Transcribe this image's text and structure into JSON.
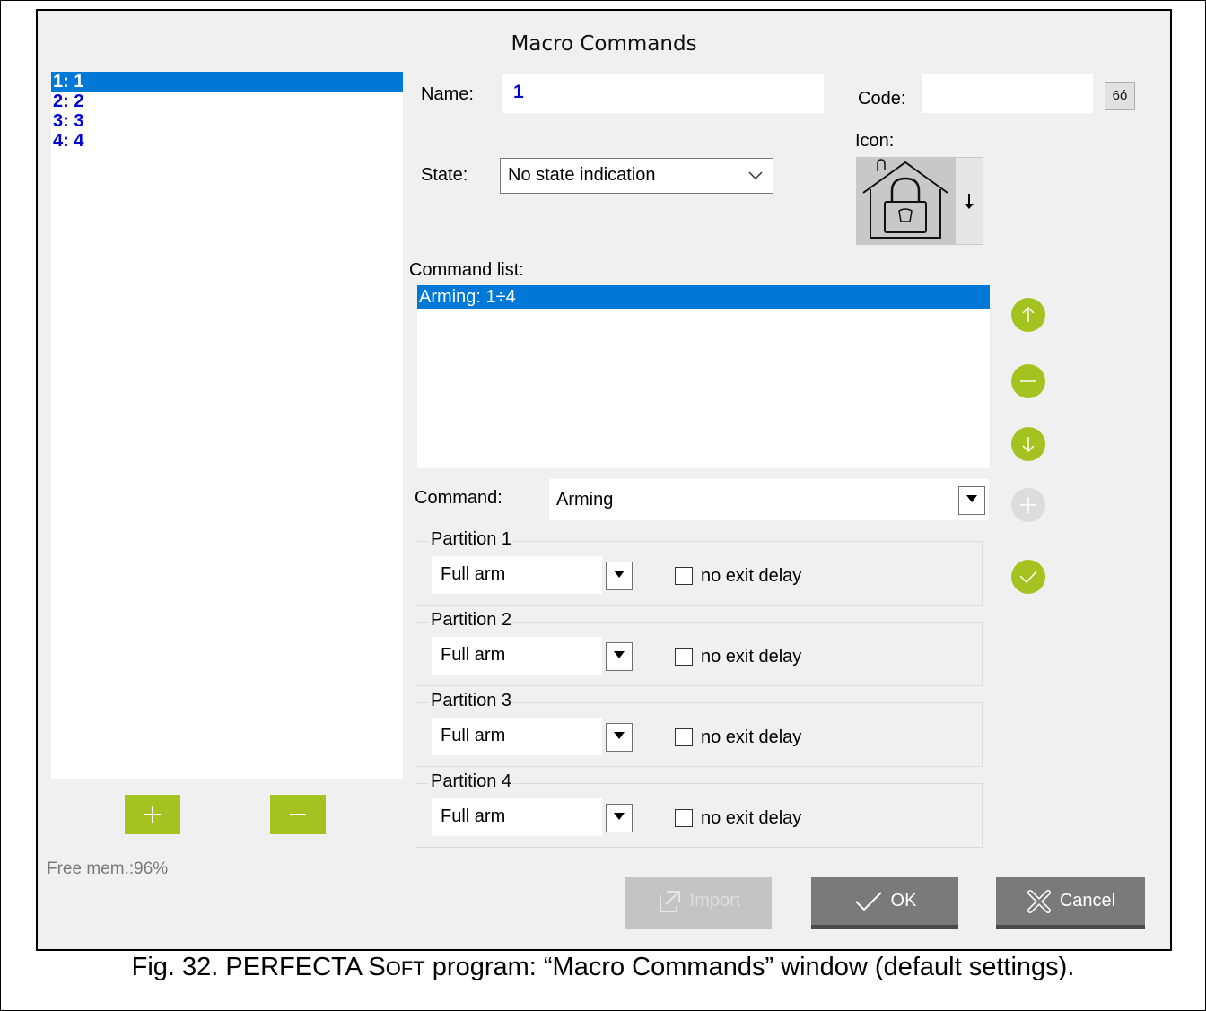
{
  "window": {
    "title": "Macro Commands"
  },
  "macros": {
    "items": [
      {
        "label": "1: 1"
      },
      {
        "label": "2: 2"
      },
      {
        "label": "3: 3"
      },
      {
        "label": "4: 4"
      }
    ],
    "selected_index": 0,
    "free_mem": "Free mem.:96%"
  },
  "form": {
    "name_label": "Name:",
    "name_value": "1",
    "code_label": "Code:",
    "code_value": "",
    "peek_glyph": "6ó",
    "icon_label": "Icon:",
    "state_label": "State:",
    "state_value": "No state indication",
    "command_list_label": "Command list:",
    "command_list": [
      {
        "label": "Arming: 1÷4",
        "selected": true
      }
    ],
    "command_label": "Command:",
    "command_value": "Arming"
  },
  "partitions": [
    {
      "legend": "Partition 1",
      "mode": "Full arm",
      "no_exit_delay_label": "no exit delay",
      "no_exit_delay": false
    },
    {
      "legend": "Partition 2",
      "mode": "Full arm",
      "no_exit_delay_label": "no exit delay",
      "no_exit_delay": false
    },
    {
      "legend": "Partition 3",
      "mode": "Full arm",
      "no_exit_delay_label": "no exit delay",
      "no_exit_delay": false
    },
    {
      "legend": "Partition 4",
      "mode": "Full arm",
      "no_exit_delay_label": "no exit delay",
      "no_exit_delay": false
    }
  ],
  "buttons": {
    "import_label": "Import",
    "ok_label": "OK",
    "cancel_label": "Cancel"
  },
  "caption": {
    "prefix": "Fig. 32. PERFECTA S",
    "smallcaps": "OFT",
    "suffix": " program: “Macro Commands” window (default settings)."
  },
  "colors": {
    "accent_green": "#a5c320",
    "selection_blue": "#0078d7",
    "macro_text_blue": "#0000d8",
    "button_gray": "#7a7a7a"
  }
}
